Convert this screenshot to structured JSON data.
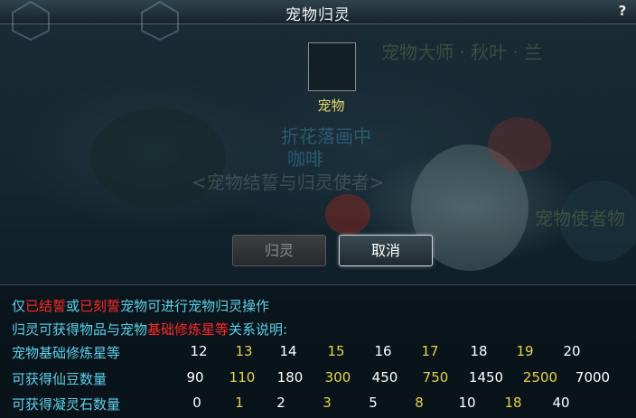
{
  "dialog": {
    "title": "宠物归灵",
    "help_icon": "?",
    "pet_slot_label": "宠物"
  },
  "background_text": {
    "npc_name": "宠物大师 · 秋叶 · 兰",
    "player_guild": "折花落画中",
    "player_name": "咖啡",
    "npc_title": "<宠物结誓与归灵使者>",
    "npc_right": "宠物使者物"
  },
  "buttons": {
    "return_label": "归灵",
    "cancel_label": "取消"
  },
  "info": {
    "line1": {
      "prefix": "仅",
      "red1": "已结誓",
      "mid": "或",
      "red2": "已刻誓",
      "suffix": "宠物可进行宠物归灵操作"
    },
    "line2": {
      "prefix": "归灵可获得物品与宠物",
      "red": "基础修炼星等",
      "suffix": "关系说明:"
    }
  },
  "table": {
    "rows": [
      {
        "label": "宠物基础修炼星等",
        "values": [
          "12",
          "13",
          "14",
          "15",
          "16",
          "17",
          "18",
          "19",
          "20"
        ]
      },
      {
        "label": "可获得仙豆数量",
        "values": [
          "90",
          "110",
          "180",
          "300",
          "450",
          "750",
          "1450",
          "2500",
          "7000"
        ]
      },
      {
        "label": "可获得凝灵石数量",
        "values": [
          "0",
          "1",
          "2",
          "3",
          "5",
          "8",
          "10",
          "18",
          "40"
        ]
      }
    ]
  },
  "colors": {
    "cyan_text": "#5fd0ea",
    "red_text": "#ff2a2a",
    "yellow_value": "#e6d24a",
    "white_value": "#ffffff",
    "slot_label": "#e8d96a"
  }
}
